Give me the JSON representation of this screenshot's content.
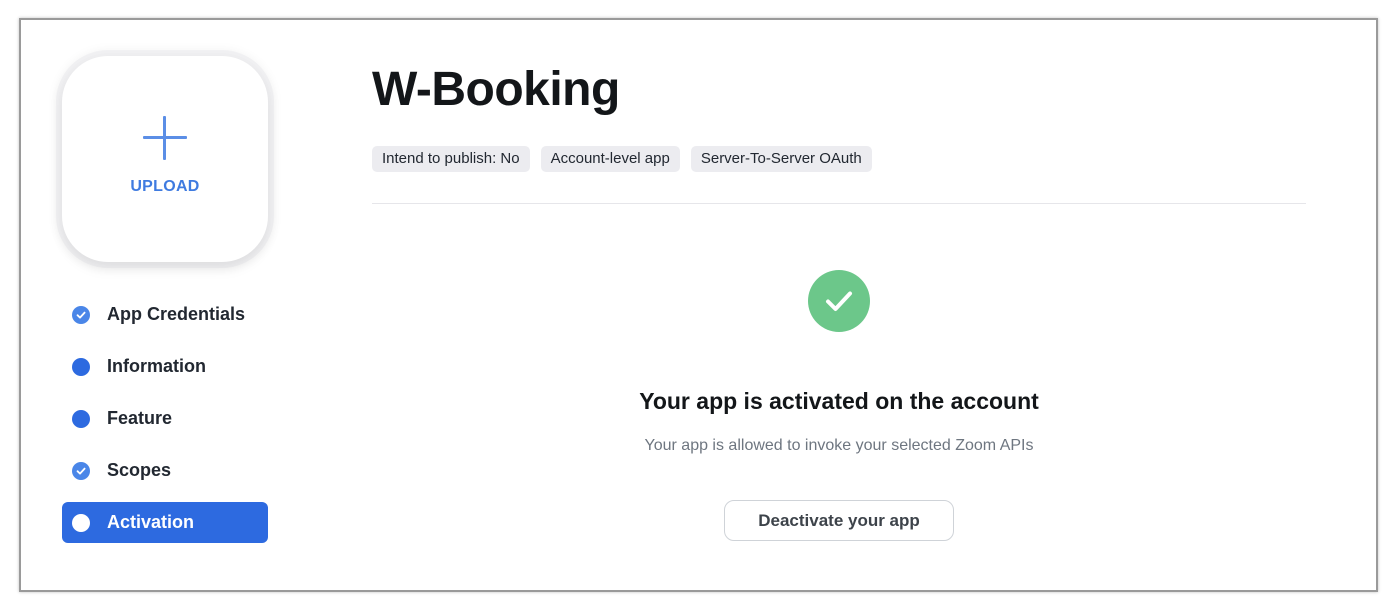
{
  "upload": {
    "label": "UPLOAD"
  },
  "nav": {
    "items": [
      {
        "label": "App Credentials",
        "icon": "check-circle-icon",
        "status": "completed"
      },
      {
        "label": "Information",
        "icon": "dot-icon",
        "status": "pending"
      },
      {
        "label": "Feature",
        "icon": "dot-icon",
        "status": "pending"
      },
      {
        "label": "Scopes",
        "icon": "check-circle-icon",
        "status": "completed"
      },
      {
        "label": "Activation",
        "icon": "dot-icon",
        "status": "active"
      }
    ]
  },
  "app": {
    "title": "W-Booking",
    "tags": [
      "Intend to publish: No",
      "Account-level app",
      "Server-To-Server OAuth"
    ]
  },
  "status": {
    "icon": "check-icon",
    "title": "Your app is activated on the account",
    "subtitle": "Your app is allowed to invoke your selected Zoom APIs",
    "button_label": "Deactivate your app"
  },
  "colors": {
    "accent": "#2d6ae0",
    "success": "#6cc78a",
    "upload_text": "#3f7be0"
  }
}
